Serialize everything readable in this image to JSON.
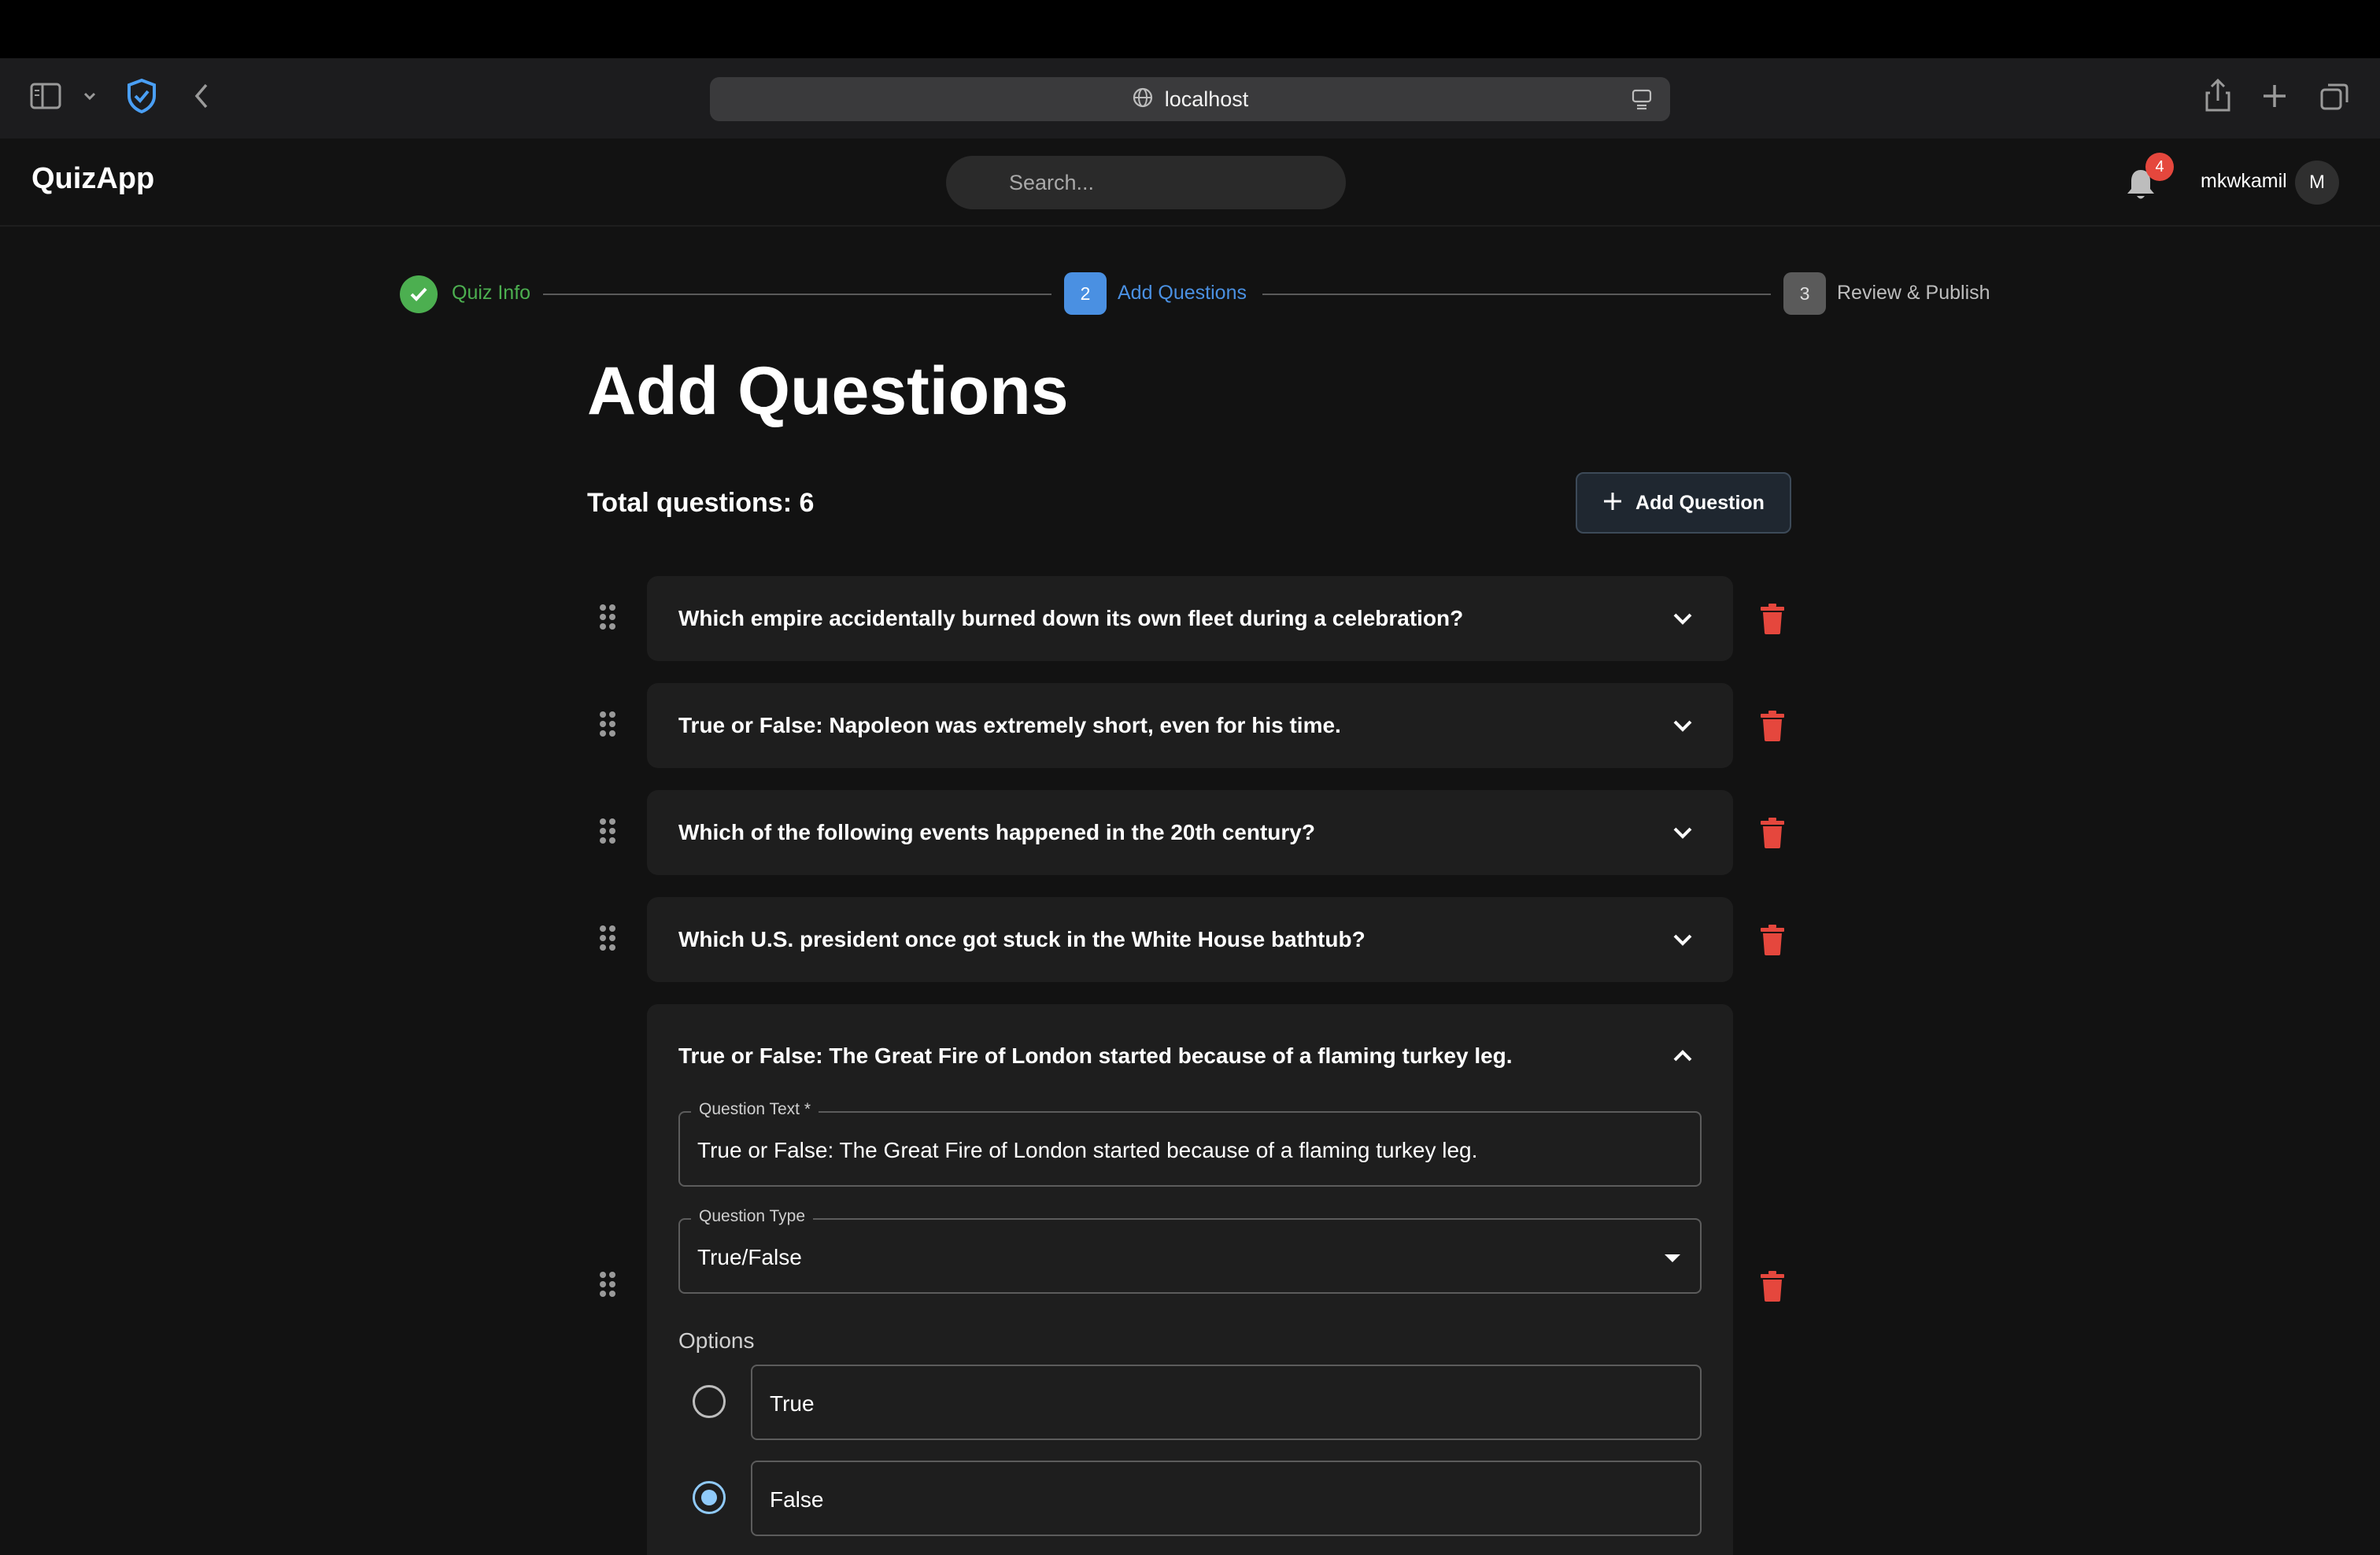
{
  "browser": {
    "url": "localhost"
  },
  "header": {
    "brand": "QuizApp",
    "search_placeholder": "Search...",
    "notification_count": "4",
    "username": "mkwkamil",
    "avatar_initial": "M"
  },
  "stepper": {
    "steps": [
      {
        "label": "Quiz Info",
        "state": "completed"
      },
      {
        "number": "2",
        "label": "Add Questions",
        "state": "active"
      },
      {
        "number": "3",
        "label": "Review & Publish",
        "state": "pending"
      }
    ]
  },
  "main": {
    "title": "Add Questions",
    "total_questions": "Total questions: 6",
    "add_question_label": "Add Question",
    "questions": [
      {
        "text": "Which empire accidentally burned down its own fleet during a celebration?"
      },
      {
        "text": "True or False: Napoleon was extremely short, even for his time."
      },
      {
        "text": "Which of the following events happened in the 20th century?"
      },
      {
        "text": "Which U.S. president once got stuck in the White House bathtub?"
      }
    ],
    "expanded_question": {
      "header_text": "True or False: The Great Fire of London started because of a flaming turkey leg.",
      "question_text_label": "Question Text *",
      "question_text_value": "True or False: The Great Fire of London started because of a flaming turkey leg.",
      "question_type_label": "Question Type",
      "question_type_value": "True/False",
      "options_label": "Options",
      "options": [
        {
          "label": "True",
          "selected": false
        },
        {
          "label": "False",
          "selected": true
        }
      ]
    }
  },
  "colors": {
    "background": "#121212",
    "card": "#1e1e1e",
    "success": "#4caf50",
    "accent": "#4a90e2",
    "danger": "#e5473d",
    "radio_selected": "#90caf9"
  },
  "icons": [
    "sidebar-icon",
    "shield-icon",
    "back-icon",
    "globe-icon",
    "reader-icon",
    "share-icon",
    "plus-icon",
    "tabs-icon",
    "bell-icon",
    "check-icon",
    "drag-handle-icon",
    "chevron-down-icon",
    "chevron-up-icon",
    "trash-icon",
    "caret-down-icon"
  ]
}
